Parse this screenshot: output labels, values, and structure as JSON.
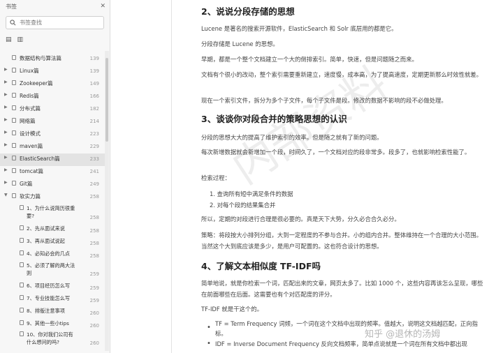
{
  "sidebar": {
    "title": "书签",
    "close_icon": "close-icon",
    "search_placeholder": "书签查找",
    "toggle_icons": [
      "list-view-icon",
      "bookmark-view-icon"
    ],
    "items": [
      {
        "label": "数据结构与算法篇",
        "page": "139"
      },
      {
        "label": "Linux篇",
        "page": "139"
      },
      {
        "label": "Zookeeper篇",
        "page": "149"
      },
      {
        "label": "Redis篇",
        "page": "166"
      },
      {
        "label": "分布式篇",
        "page": "182"
      },
      {
        "label": "网络篇",
        "page": "214"
      },
      {
        "label": "设计模式",
        "page": "223"
      },
      {
        "label": "maven篇",
        "page": "229"
      },
      {
        "label": "ElasticSearch篇",
        "page": "233"
      },
      {
        "label": "tomcat篇",
        "page": "241"
      },
      {
        "label": "Git篇",
        "page": "249"
      },
      {
        "label": "软实力篇",
        "page": "258"
      }
    ],
    "sub_items": [
      {
        "label": "1、为什么说简历很重要?",
        "page": "258"
      },
      {
        "label": "2、先从面试来说",
        "page": "258"
      },
      {
        "label": "3、再从面试说起",
        "page": "258"
      },
      {
        "label": "4、必知必会的几点",
        "page": "258"
      },
      {
        "label": "5、必须了解的两大法则",
        "page": "259"
      },
      {
        "label": "6、项目经历怎么写",
        "page": "259"
      },
      {
        "label": "7、专业技能怎么写",
        "page": "259"
      },
      {
        "label": "8、排版注意事项",
        "page": "260"
      },
      {
        "label": "9、其他一些小tips",
        "page": "260"
      },
      {
        "label": "10、你对我们公司有什么想问的吗?",
        "page": "260"
      }
    ]
  },
  "document": {
    "s2_heading": "2、说说分段存储的思想",
    "s2_p1": "Lucene 是著名的搜索开源软件，ElasticSearch 和 Solr 底层用的都是它。",
    "s2_p2": "分段存储是 Lucene 的思想。",
    "s2_p3": "早期，都是一个整个文档建立一个大的倒排索引。简单，快速，但是问题随之而来。",
    "s2_p4": "文档有个很小的改动，整个索引需要重新建立，速度慢，成本高，为了提高速度，定期更新那么时效性就差。",
    "s2_p5": "现在一个索引文件，拆分为多个子文件，每个子文件是段。修改的数据不影响的段不必做处理。",
    "s3_heading": "3、谈谈你对段合并的策略思想的认识",
    "s3_p1": "分段的思想大大的提高了维护索引的效率。但是随之就有了新的问题。",
    "s3_p2": "每次新增数据就会新增加一个段，时间久了，一个文档对应的段非常多。段多了，也就影响检索性能了。",
    "s3_p3": "检索过程：",
    "s3_list": [
      "1. 查询所有短中满足条件的数据",
      "2. 对每个段的结果集合并"
    ],
    "s3_p4": "所以，定期的对段进行合理是很必要的。真是天下大势，分久必合合久必分。",
    "s3_p5": "策略：将段按大小排列分组，大到一定程度的不参与合并。小的组内合并。整体维持在一个合理的大小范围。当然这个大到底应该是多少，是用户可配置的。这也符合设计的思想。",
    "s4_heading": "4、了解文本相似度 TF-IDF吗",
    "s4_p1": "简单地说，就是你检索一个词，匹配出来的文章，网页太多了。比如 1000 个，这些内容再该怎么呈现，哪些在前面哪些在后面。这需要也有个对匹配度的评分。",
    "s4_p2": "TF-IDF 就是干这个的。",
    "s4_bullet1": "TF = Term Frequency 词频，一个词在这个文档中出现的频率。值越大，说明这文档越匹配，正向指标。",
    "s4_bullet2": "IDF = Inverse Document Frequency 反向文档频率，简单点说就是一个词在所有文档中都出现",
    "watermark": "内部资料",
    "zhihu_watermark": "知乎 @退休的汤姆"
  }
}
